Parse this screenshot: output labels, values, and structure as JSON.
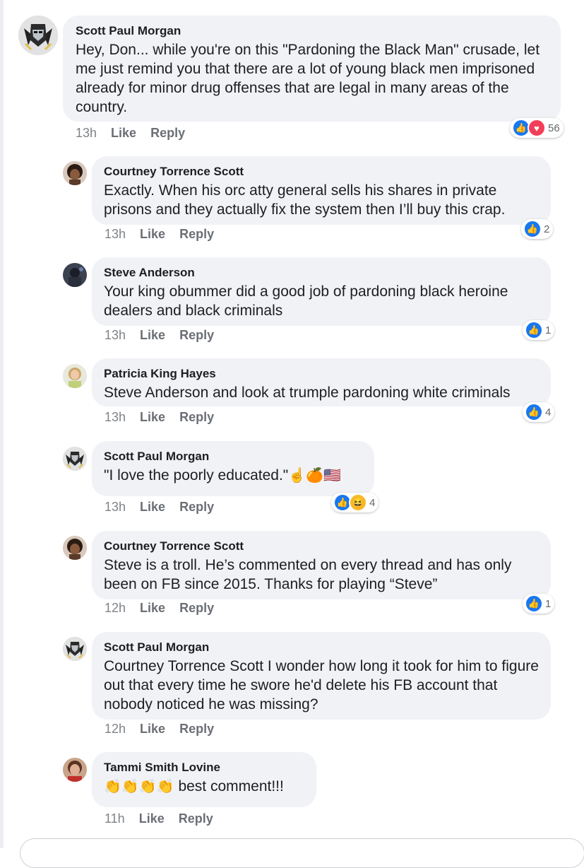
{
  "comments": [
    {
      "author": "Scott Paul Morgan",
      "text": "Hey, Don... while you're on this \"Pardoning the Black Man\" crusade, let me just remind you that there are a lot of young black men imprisoned already for minor drug offenses that are legal in many areas of the country.",
      "time": "13h",
      "like": "Like",
      "reply": "Reply",
      "reaction_count": "56"
    },
    {
      "author": "Courtney Torrence Scott",
      "text": "Exactly. When his orc atty general sells his shares in private prisons and they actually fix the system then I’ll buy this crap.",
      "time": "13h",
      "like": "Like",
      "reply": "Reply",
      "reaction_count": "2"
    },
    {
      "author": "Steve Anderson",
      "text": "Your king obummer did a good job of pardoning black heroine dealers and black criminals",
      "time": "13h",
      "like": "Like",
      "reply": "Reply",
      "reaction_count": "1"
    },
    {
      "author": "Patricia King Hayes",
      "text": "Steve Anderson and look at trumple pardoning white criminals",
      "time": "13h",
      "like": "Like",
      "reply": "Reply",
      "reaction_count": "4"
    },
    {
      "author": "Scott Paul Morgan",
      "text": "\"I love the poorly educated.\"",
      "emoji": "☝️🍊🇺🇸",
      "time": "13h",
      "like": "Like",
      "reply": "Reply",
      "reaction_count": "4"
    },
    {
      "author": "Courtney Torrence Scott",
      "text": "Steve is a troll. He’s commented on every thread and has only been on FB since 2015. Thanks for playing “Steve”",
      "time": "12h",
      "like": "Like",
      "reply": "Reply",
      "reaction_count": "1"
    },
    {
      "author": "Scott Paul Morgan",
      "text": "Courtney Torrence Scott I wonder how long it took for him to figure out that every time he swore he'd delete his FB account that nobody noticed he was missing?",
      "time": "12h",
      "like": "Like",
      "reply": "Reply",
      "reaction_count": "1"
    },
    {
      "author": "Tammi Smith Lovine",
      "emoji": "👏👏👏👏",
      "text": " best comment!!!",
      "time": "11h",
      "like": "Like",
      "reply": "Reply"
    }
  ],
  "colors": {
    "bubble": "#f1f2f6",
    "like_blue": "#1877f2",
    "love_red": "#f33e58",
    "meta_gray": "#7f8388"
  },
  "icons": {
    "like": "like-reaction-icon",
    "love": "love-reaction-icon",
    "haha": "haha-reaction-icon"
  }
}
